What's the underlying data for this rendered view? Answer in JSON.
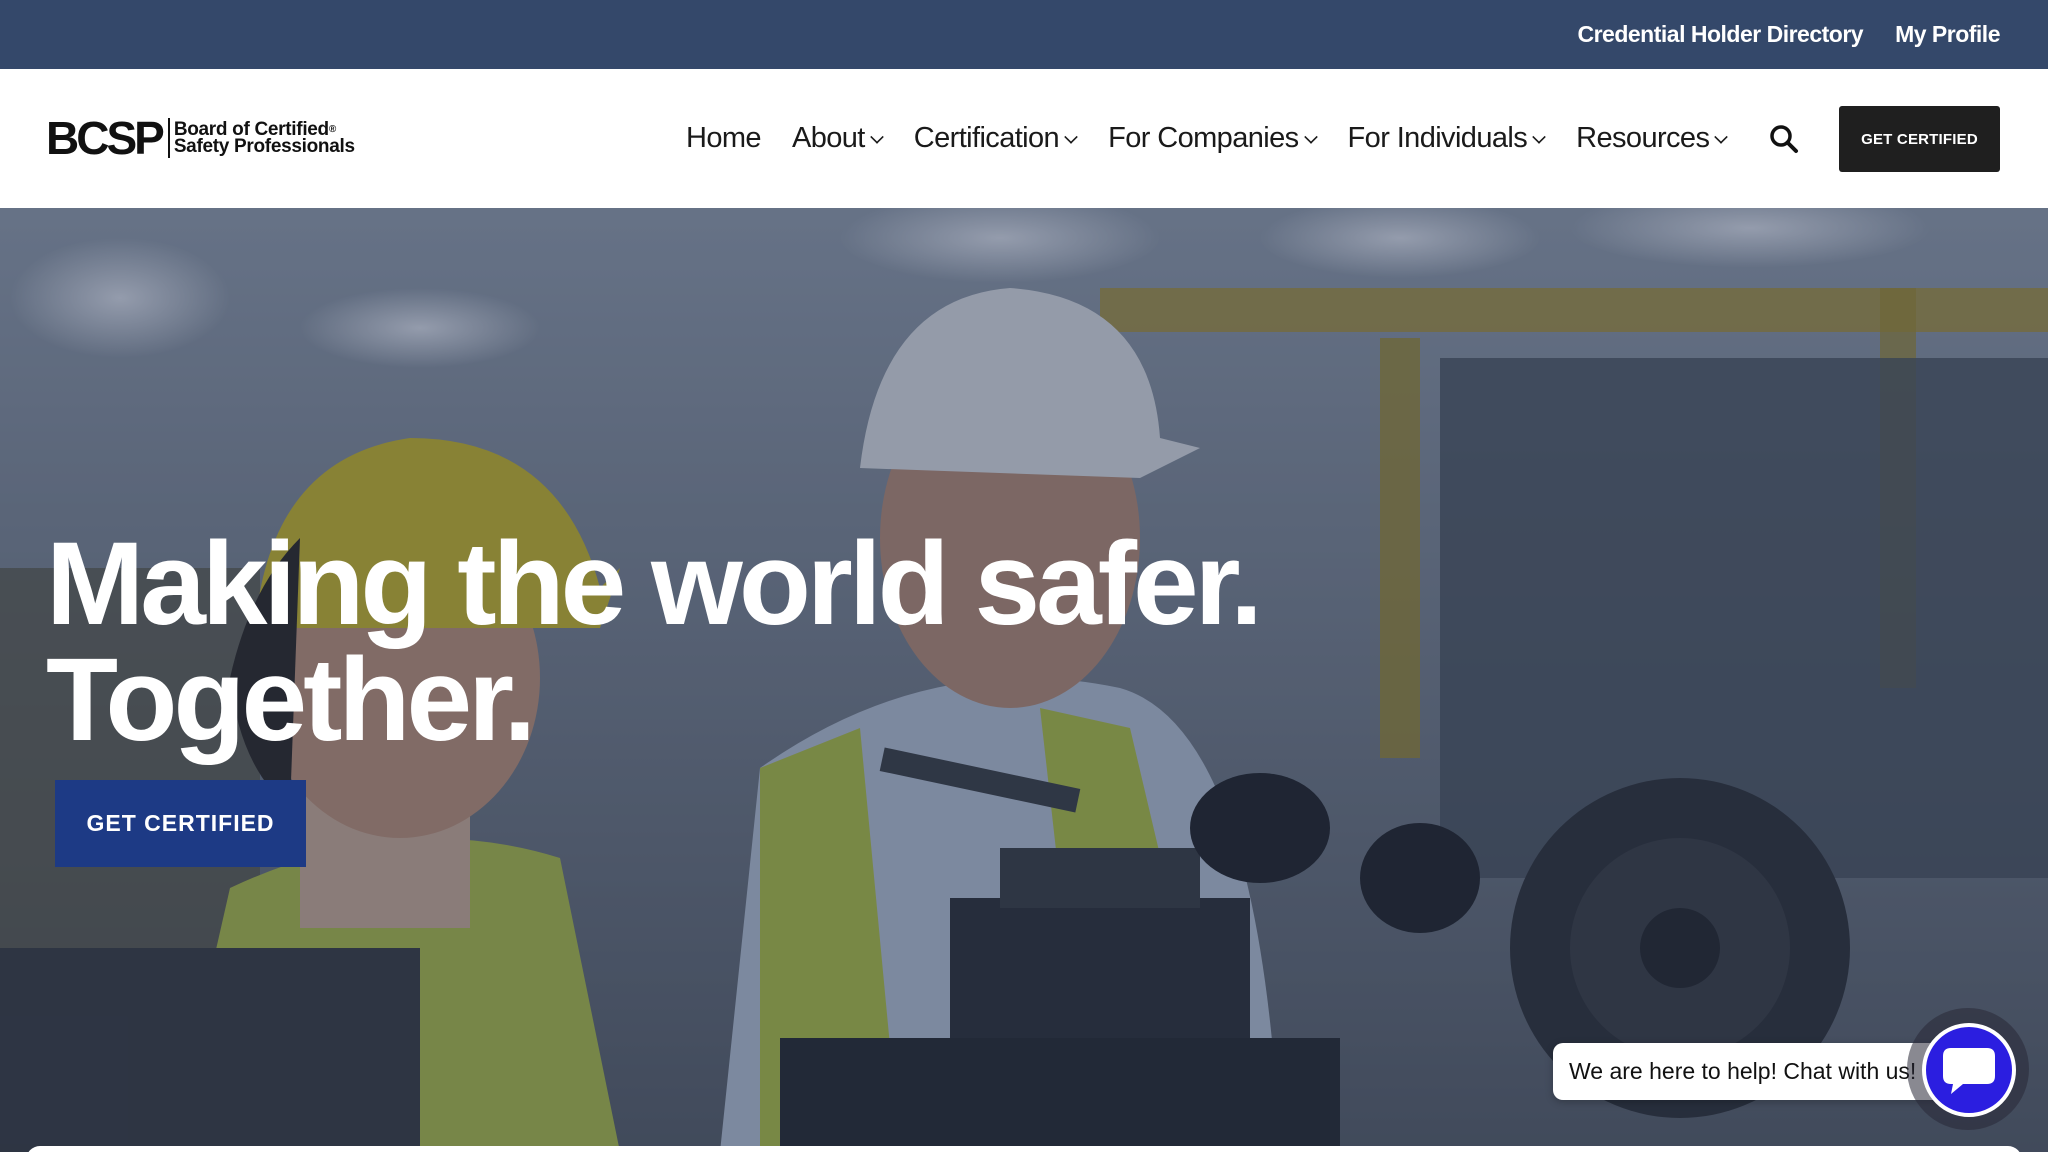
{
  "utility_nav": {
    "directory_label": "Credential Holder Directory",
    "profile_label": "My Profile"
  },
  "brand": {
    "mark": "BCSP",
    "line1": "Board of Certified",
    "line2": "Safety Professionals",
    "registered": "®"
  },
  "nav": {
    "items": [
      {
        "label": "Home",
        "dropdown": false
      },
      {
        "label": "About",
        "dropdown": true
      },
      {
        "label": "Certification",
        "dropdown": true
      },
      {
        "label": "For Companies",
        "dropdown": true
      },
      {
        "label": "For Individuals",
        "dropdown": true
      },
      {
        "label": "Resources",
        "dropdown": true
      }
    ],
    "search_icon": "search-icon",
    "cta_label": "GET CERTIFIED"
  },
  "hero": {
    "title_line1": "Making the world safer.",
    "title_line2": "Together.",
    "cta_label": "GET CERTIFIED"
  },
  "chat": {
    "prompt": "We are here to help! Chat with us!",
    "icon": "chat-icon"
  },
  "colors": {
    "utility_bar": "#34486a",
    "header_cta": "#1f1f1f",
    "hero_cta": "#1d3a85",
    "chat_accent": "#2b1ee0"
  }
}
